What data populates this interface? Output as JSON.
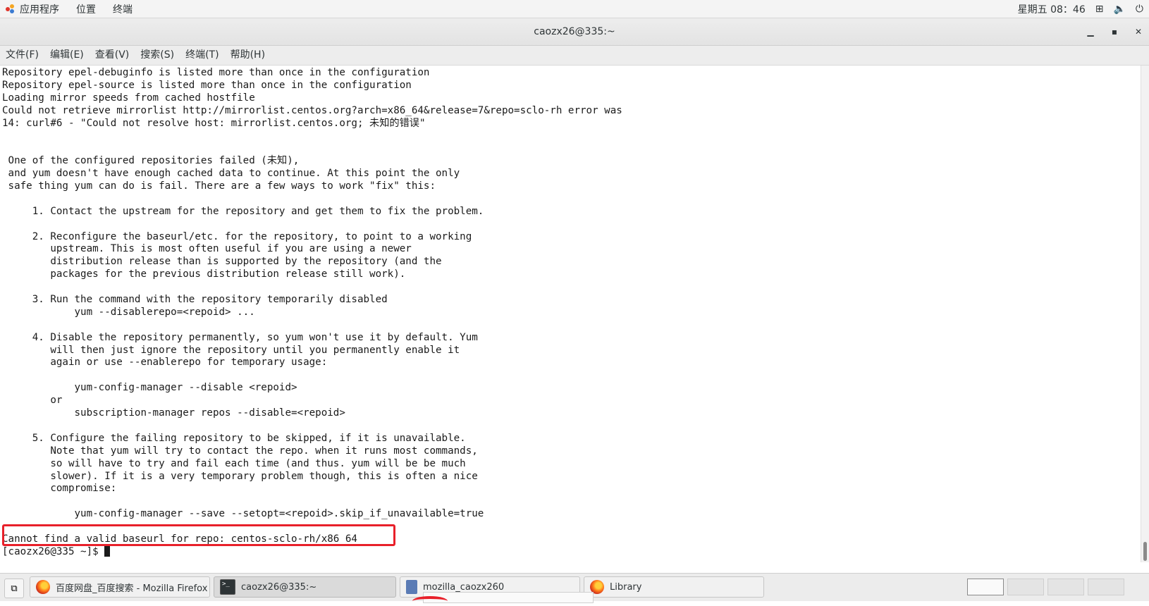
{
  "top_panel": {
    "applications": "应用程序",
    "places": "位置",
    "terminal": "终端",
    "clock": "星期五 08：46",
    "icons": [
      "network-icon",
      "volume-icon",
      "power-icon"
    ]
  },
  "window": {
    "title": "caozx26@335:~",
    "minimize": "▁",
    "maximize": "▪",
    "close": "✕"
  },
  "menu": {
    "items": [
      "文件(F)",
      "编辑(E)",
      "查看(V)",
      "搜索(S)",
      "终端(T)",
      "帮助(H)"
    ]
  },
  "terminal": {
    "lines": [
      "Repository epel-debuginfo is listed more than once in the configuration",
      "Repository epel-source is listed more than once in the configuration",
      "Loading mirror speeds from cached hostfile",
      "Could not retrieve mirrorlist http://mirrorlist.centos.org?arch=x86_64&release=7&repo=sclo-rh error was",
      "14: curl#6 - \"Could not resolve host: mirrorlist.centos.org; 未知的错误\"",
      "",
      "",
      " One of the configured repositories failed (未知),",
      " and yum doesn't have enough cached data to continue. At this point the only",
      " safe thing yum can do is fail. There are a few ways to work \"fix\" this:",
      "",
      "     1. Contact the upstream for the repository and get them to fix the problem.",
      "",
      "     2. Reconfigure the baseurl/etc. for the repository, to point to a working",
      "        upstream. This is most often useful if you are using a newer",
      "        distribution release than is supported by the repository (and the",
      "        packages for the previous distribution release still work).",
      "",
      "     3. Run the command with the repository temporarily disabled",
      "            yum --disablerepo=<repoid> ...",
      "",
      "     4. Disable the repository permanently, so yum won't use it by default. Yum",
      "        will then just ignore the repository until you permanently enable it",
      "        again or use --enablerepo for temporary usage:",
      "",
      "            yum-config-manager --disable <repoid>",
      "        or",
      "            subscription-manager repos --disable=<repoid>",
      "",
      "     5. Configure the failing repository to be skipped, if it is unavailable.",
      "        Note that yum will try to contact the repo. when it runs most commands,",
      "        so will have to try and fail each time (and thus. yum will be be much",
      "        slower). If it is a very temporary problem though, this is often a nice",
      "        compromise:",
      "",
      "            yum-config-manager --save --setopt=<repoid>.skip_if_unavailable=true",
      "",
      "Cannot find a valid baseurl for repo: centos-sclo-rh/x86_64"
    ],
    "prompt": "[caozx26@335 ~]$ "
  },
  "taskbar": {
    "tasks": [
      {
        "label": "百度网盘_百度搜索 - Mozilla Firefox",
        "icon": "firefox-icon"
      },
      {
        "label": "caozx26@335:~",
        "icon": "terminal-icon"
      },
      {
        "label": "mozilla_caozx260",
        "icon": "document-icon"
      },
      {
        "label": "Library",
        "icon": "firefox-icon"
      }
    ],
    "workspaces": 4
  },
  "colors": {
    "highlight": "#e8202a",
    "panel": "#f4f4f4",
    "terminal_bg": "#ffffff",
    "terminal_fg": "#1a1a1a"
  }
}
